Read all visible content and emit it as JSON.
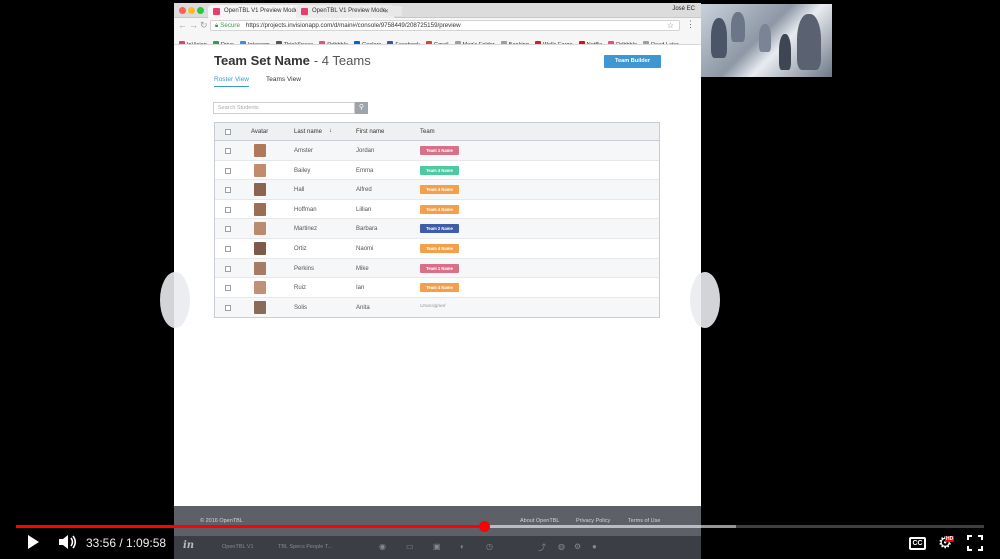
{
  "browser": {
    "tabs": [
      {
        "title": "OpenTBL V1 Preview Mode"
      },
      {
        "title": "OpenTBL V1 Preview Mode"
      }
    ],
    "profile": "José EC",
    "address": {
      "secure_label": "Secure",
      "url": "https://projects.invisionapp.com/d/main#/console/9758449/208725159/preview"
    },
    "bookmarks": [
      {
        "label": "InVision",
        "color": "#ea3d6f"
      },
      {
        "label": "Drive",
        "color": "#2f9e58"
      },
      {
        "label": "Intercom",
        "color": "#3a8ee6"
      },
      {
        "label": "ThinkSpace",
        "color": "#555555"
      },
      {
        "label": "Dribbble",
        "color": "#ea4c89"
      },
      {
        "label": "Coolors",
        "color": "#0066cc"
      },
      {
        "label": "Facebook",
        "color": "#3b5998"
      },
      {
        "label": "Gmail",
        "color": "#d44638"
      },
      {
        "label": "Meg's Folder",
        "color": "#9e9e9e"
      },
      {
        "label": "Banking",
        "color": "#9e9e9e"
      },
      {
        "label": "Wells Fargo",
        "color": "#d71e28"
      },
      {
        "label": "Netflix",
        "color": "#e50914"
      },
      {
        "label": "Dribbble",
        "color": "#ea4c89"
      },
      {
        "label": "Read Later",
        "color": "#9e9e9e"
      }
    ]
  },
  "page": {
    "title": "Team Set Name",
    "subtitle": "- 4 Teams",
    "team_builder_label": "Team Builder",
    "tabs": {
      "roster": "Roster View",
      "teams": "Teams View"
    },
    "search_placeholder": "Search Students",
    "columns": {
      "avatar": "Avatar",
      "last_name": "Last name",
      "first_name": "First name",
      "team": "Team"
    },
    "rows": [
      {
        "last": "Amster",
        "first": "Jordan",
        "team": "Team 1 Name",
        "color": "#d9708a"
      },
      {
        "last": "Bailey",
        "first": "Emma",
        "team": "Team 4 Name",
        "color": "#4ec9a0"
      },
      {
        "last": "Hall",
        "first": "Alfred",
        "team": "Team 4 Name",
        "color": "#f2a04a"
      },
      {
        "last": "Hoffman",
        "first": "Lillian",
        "team": "Team 4 Name",
        "color": "#f2a04a"
      },
      {
        "last": "Martinez",
        "first": "Barbara",
        "team": "Team 2 Name",
        "color": "#3f5ca8"
      },
      {
        "last": "Ortiz",
        "first": "Naomi",
        "team": "Team 4 Name",
        "color": "#f2a04a"
      },
      {
        "last": "Perkins",
        "first": "Mike",
        "team": "Team 1 Name",
        "color": "#d9708a"
      },
      {
        "last": "Ruiz",
        "first": "Ian",
        "team": "Team 4 Name",
        "color": "#f2a04a"
      },
      {
        "last": "Solis",
        "first": "Anita",
        "team": "Unassigned",
        "color": ""
      }
    ],
    "footer": {
      "copyright": "© 2016 OpenTBL",
      "links": [
        "About OpenTBL",
        "Privacy Policy",
        "Terms of Use"
      ]
    },
    "invision_toolbar": {
      "project": "OpenTBL V1",
      "screen": "TBL Specs People T..."
    }
  },
  "player": {
    "time": "33:56 / 1:09:58",
    "progress": 0.485,
    "cc_label": "CC",
    "hd_label": "HD"
  }
}
